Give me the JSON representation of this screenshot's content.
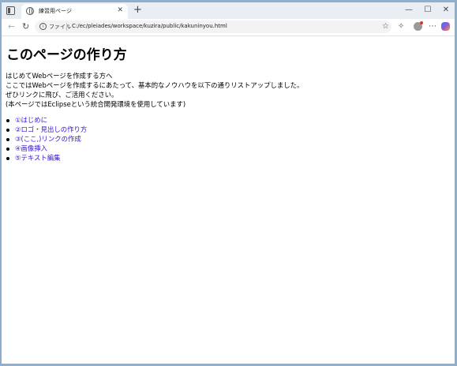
{
  "browser": {
    "tab_title": "練習用ページ",
    "file_label": "ファイル",
    "url": "C:/ec/pleiades/workspace/kuzira/public/kakuninyou.html"
  },
  "page": {
    "heading": "このページの作り方",
    "intro_lines": [
      "はじめてWebページを作成する方へ",
      "ここではWebページを作成するにあたって、基本的なノウハウを以下の通りリストアップしました。",
      "ぜひリンクに飛び、ご活用ください。",
      "(本ページではEclipseという統合開発環境を使用しています)"
    ],
    "links": [
      "①はじめに",
      "②ロゴ・見出しの作り方",
      "③(ここ,)リンクの作成",
      "④画像挿入",
      "⑤テキスト編集"
    ]
  },
  "colors": {
    "link": "#3b12d6",
    "desktop": "#8fb0cf"
  }
}
